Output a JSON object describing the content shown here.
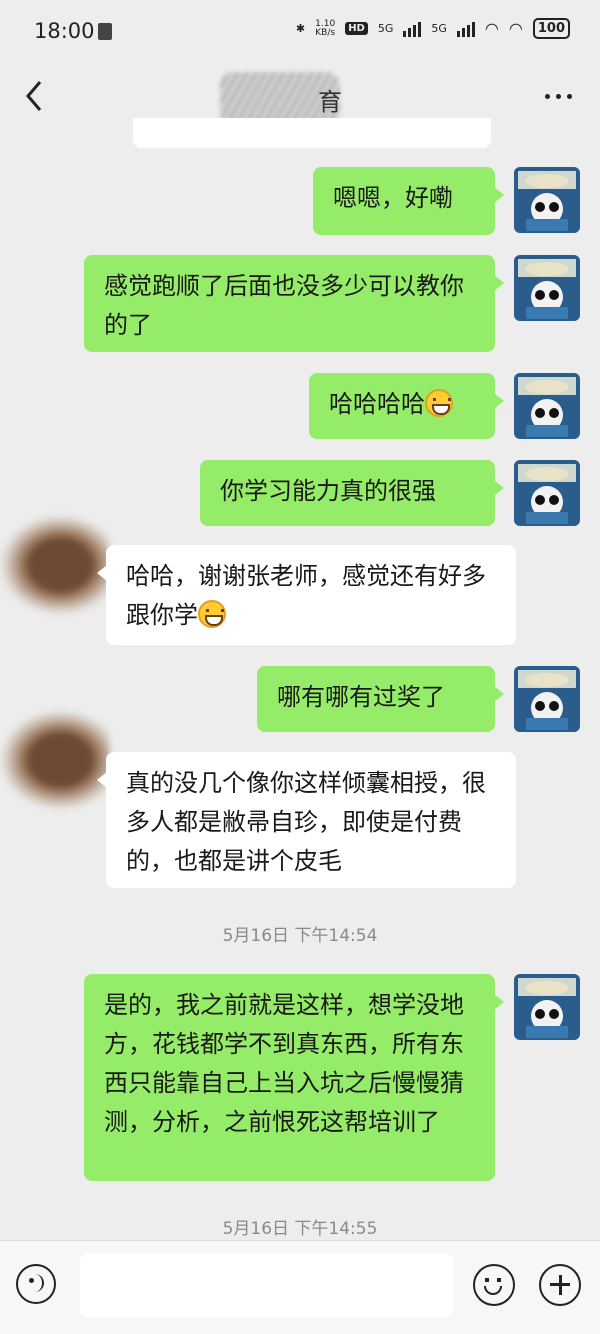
{
  "status_bar": {
    "time": "18:00",
    "net_speed": "1.10",
    "net_unit": "KB/s",
    "hd": "HD",
    "sig1": "5G",
    "sig2": "5G",
    "battery": "100"
  },
  "header": {
    "title_visible": "育",
    "back_icon": "chevron-left-icon",
    "more_icon": "more-dots-icon"
  },
  "messages": [
    {
      "side": "me",
      "text": "嗯嗯，好嘞"
    },
    {
      "side": "me",
      "text": "感觉跑顺了后面也没多少可以教你的了"
    },
    {
      "side": "me",
      "text": "哈哈哈哈",
      "emoji": "grin-emoji"
    },
    {
      "side": "me",
      "text": "你学习能力真的很强"
    },
    {
      "side": "them",
      "text": "哈哈，谢谢张老师，感觉还有好多跟你学",
      "emoji": "grin-emoji"
    },
    {
      "side": "me",
      "text": "哪有哪有过奖了"
    },
    {
      "side": "them",
      "text": "真的没几个像你这样倾囊相授，很多人都是敝帚自珍，即使是付费的，也都是讲个皮毛"
    },
    {
      "side": "me",
      "text": "是的，我之前就是这样，想学没地方，花钱都学不到真东西，所有东西只能靠自己上当入坑之后慢慢猜测，分析，之前恨死这帮培训了"
    }
  ],
  "timestamps": [
    "5月16日 下午14:54",
    "5月16日 下午14:55"
  ],
  "input_bar": {
    "placeholder": "",
    "voice_icon": "voice-icon",
    "emoji_icon": "emoji-icon",
    "plus_icon": "plus-icon"
  },
  "colors": {
    "background": "#ededed",
    "my_bubble": "#95ec69",
    "their_bubble": "#ffffff",
    "timestamp": "#8a8a8a"
  }
}
